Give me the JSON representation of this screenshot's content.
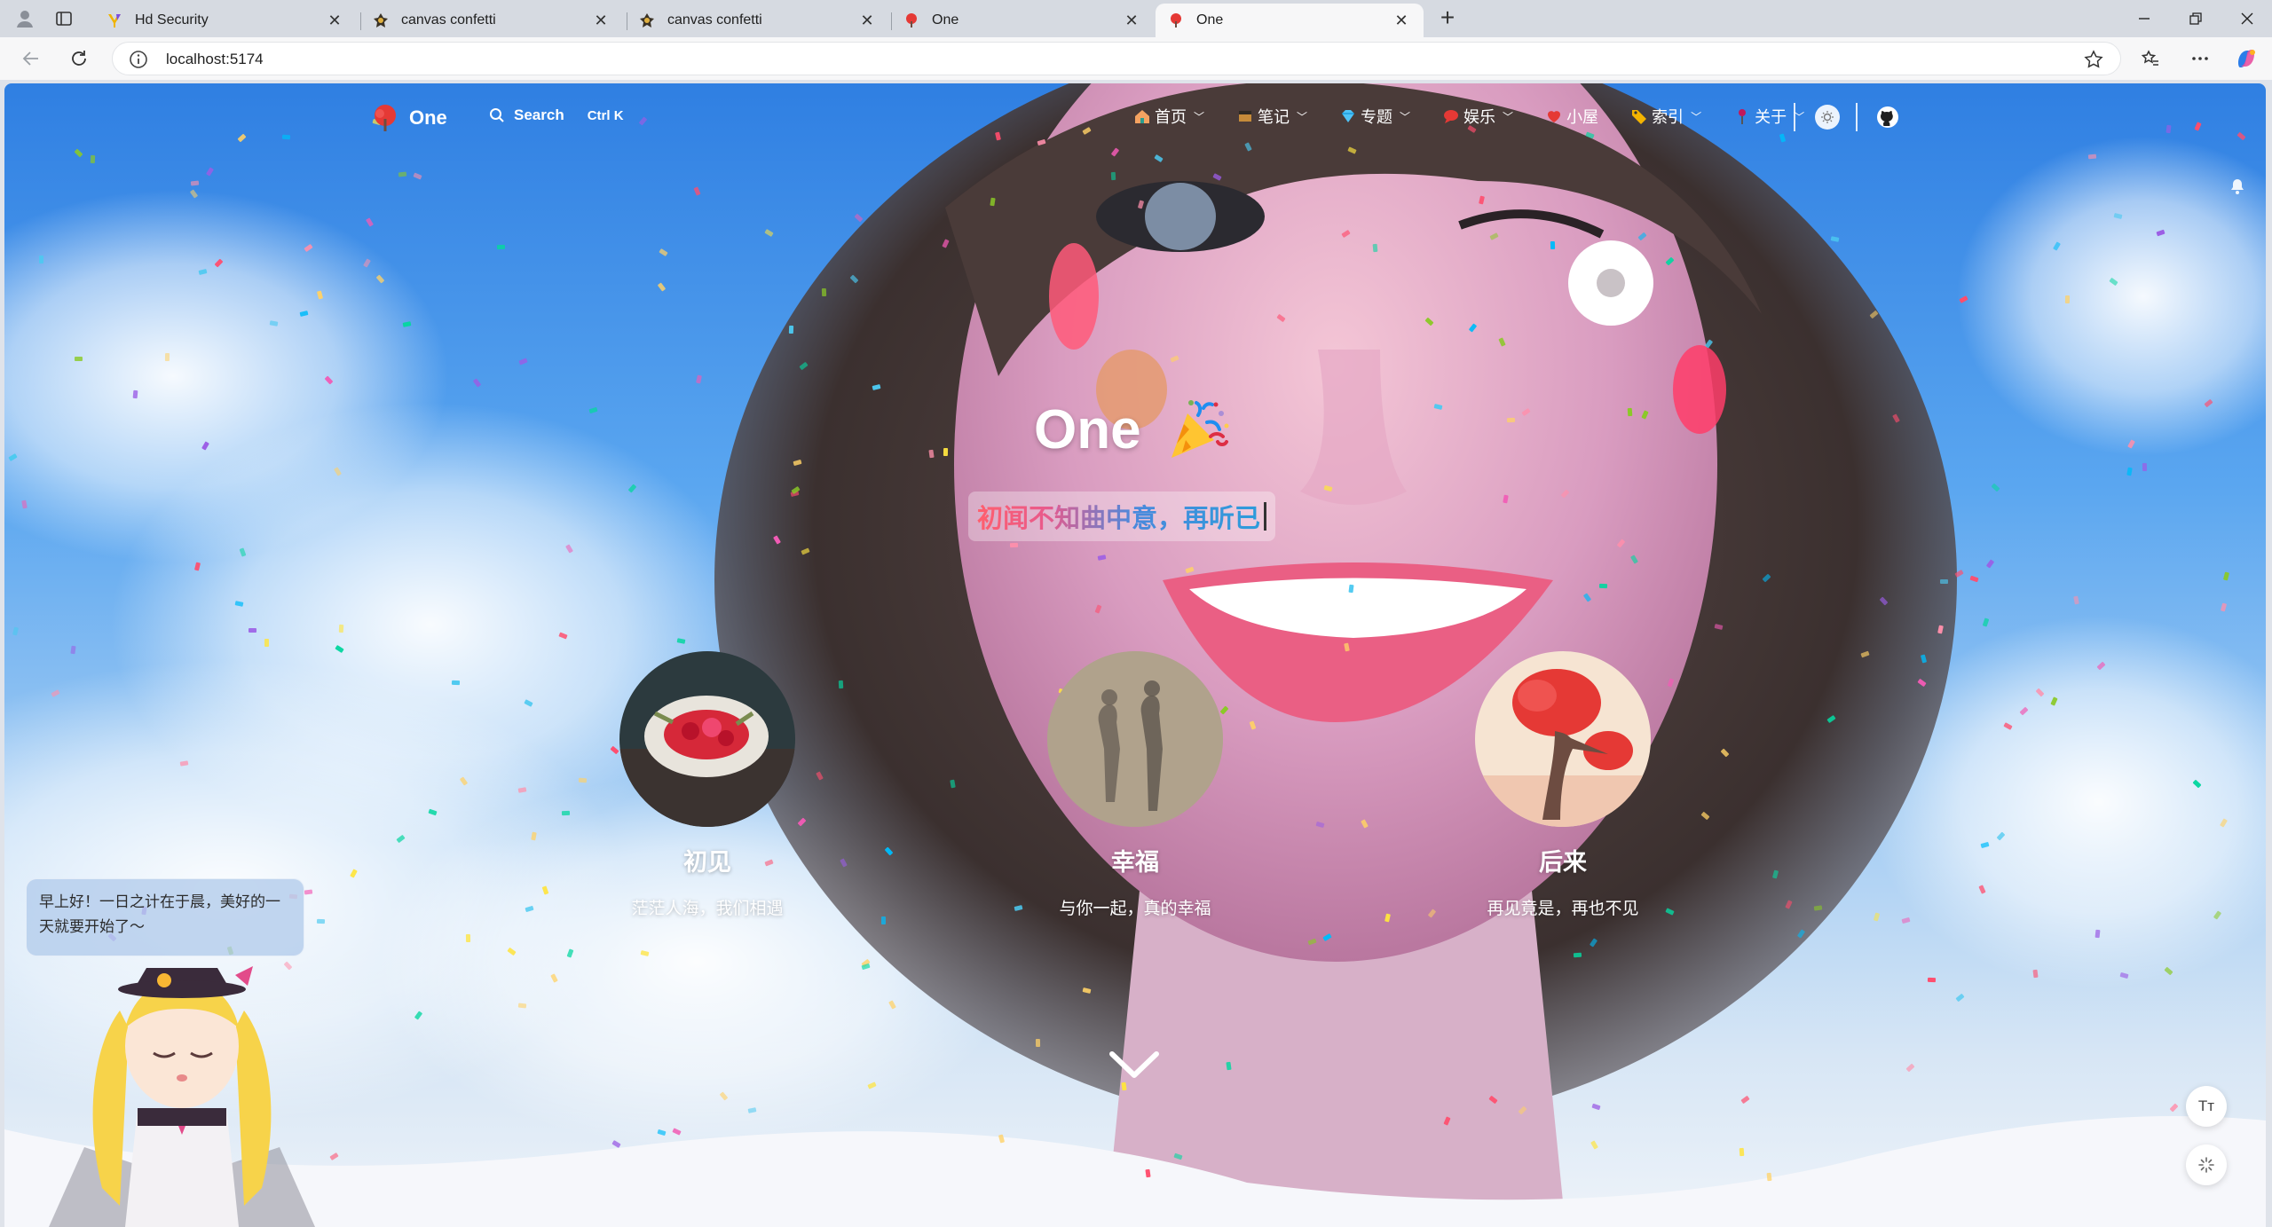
{
  "browser": {
    "tabs": [
      {
        "title": "Hd Security",
        "favicon": "hd-security-favicon",
        "active": false
      },
      {
        "title": "canvas confetti",
        "favicon": "confetti-favicon",
        "active": false
      },
      {
        "title": "canvas confetti",
        "favicon": "confetti-favicon",
        "active": false
      },
      {
        "title": "One",
        "favicon": "one-logo-favicon",
        "active": false
      },
      {
        "title": "One",
        "favicon": "one-logo-favicon",
        "active": true
      }
    ],
    "new_tab_label": "+",
    "address": "localhost:5174"
  },
  "site": {
    "logo_text": "One",
    "search_label": "Search",
    "search_shortcut": "Ctrl K",
    "nav": [
      {
        "label": "首页",
        "icon": "house-icon",
        "has_menu": true
      },
      {
        "label": "笔记",
        "icon": "notebook-icon",
        "has_menu": true
      },
      {
        "label": "专题",
        "icon": "gem-icon",
        "has_menu": true
      },
      {
        "label": "娱乐",
        "icon": "chat-bubble-icon",
        "has_menu": true
      },
      {
        "label": "小屋",
        "icon": "heart-icon",
        "has_menu": false
      },
      {
        "label": "索引",
        "icon": "tag-icon",
        "has_menu": true
      },
      {
        "label": "关于",
        "icon": "pin-icon",
        "has_menu": true
      }
    ]
  },
  "hero": {
    "title": "One",
    "slogan": "初闻不知曲中意，再听已"
  },
  "cards": [
    {
      "title": "初见",
      "desc": "茫茫人海，我们相遇",
      "image": "flower-bouquet"
    },
    {
      "title": "幸福",
      "desc": "与你一起，真的幸福",
      "image": "couple-shadow"
    },
    {
      "title": "后来",
      "desc": "再见竟是，再也不见",
      "image": "red-tree"
    }
  ],
  "assistant": {
    "greeting": "早上好！一日之计在于晨，美好的一天就要开始了～"
  },
  "floating": {
    "font_button": "Tт"
  },
  "colors": {
    "sky": "#2f7fe2",
    "slogan_start": "#ff5f6d",
    "slogan_end": "#2d9cdb",
    "chrome": "#d6dae1"
  }
}
